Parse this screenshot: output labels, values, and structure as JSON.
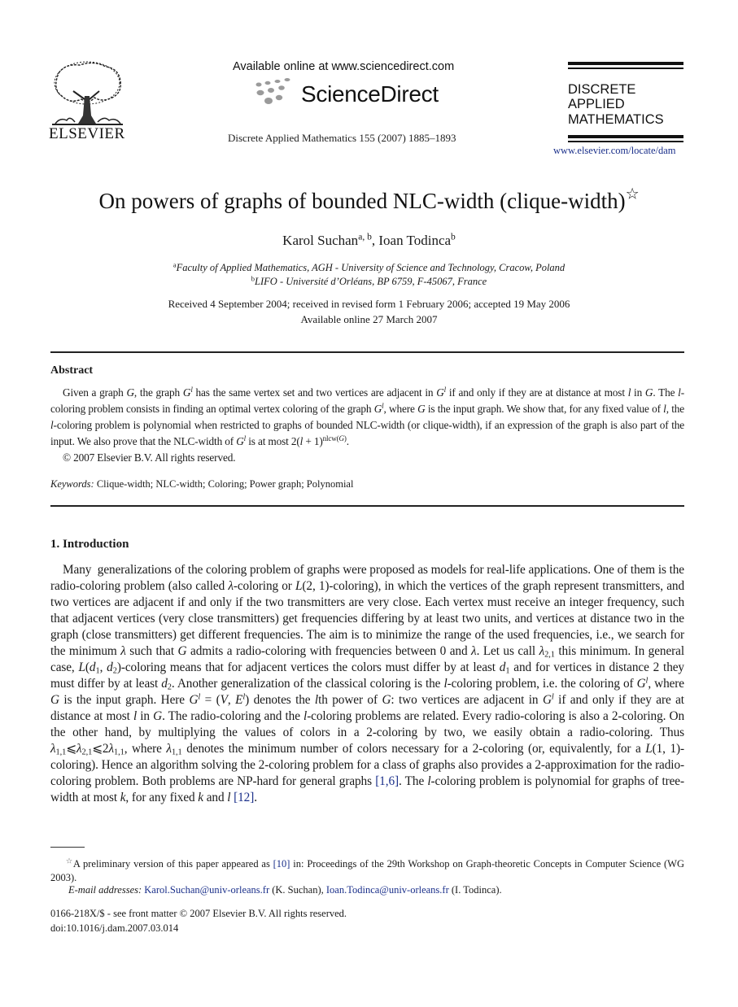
{
  "header": {
    "publisher": "ELSEVIER",
    "available_online": "Available online at www.sciencedirect.com",
    "sciencedirect": "ScienceDirect",
    "journal_ref": "Discrete Applied Mathematics 155 (2007) 1885–1893",
    "journal_title_lines": [
      "DISCRETE",
      "APPLIED",
      "MATHEMATICS"
    ],
    "journal_url": "www.elsevier.com/locate/dam"
  },
  "article": {
    "title": "On powers of graphs of bounded NLC-width (clique-width)",
    "title_note_mark": "☆",
    "authors": [
      {
        "name": "Karol Suchan",
        "affil": "a, b"
      },
      {
        "name": "Ioan Todinca",
        "affil": "b"
      }
    ],
    "author_separator": ", ",
    "affiliations": [
      {
        "mark": "a",
        "text": "Faculty of Applied Mathematics, AGH - University of Science and Technology, Cracow, Poland"
      },
      {
        "mark": "b",
        "text": "LIFO - Université d’Orléans, BP 6759, F-45067, France"
      }
    ],
    "dates": "Received 4 September 2004; received in revised form 1 February 2006; accepted 19 May 2006",
    "available": "Available online 27 March 2007"
  },
  "abstract": {
    "heading": "Abstract",
    "copyright": "© 2007 Elsevier B.V. All rights reserved."
  },
  "keywords": {
    "label": "Keywords:",
    "text": "Clique-width; NLC-width; Coloring; Power graph; Polynomial"
  },
  "section": {
    "heading": "1.  Introduction",
    "citations": [
      "[1,6]",
      "[12]"
    ]
  },
  "footnotes": {
    "mark": "☆",
    "preliminary_pre": "A preliminary version of this paper appeared as ",
    "preliminary_ref": "[10]",
    "preliminary_post": " in: Proceedings of the 29th Workshop on Graph-theoretic Concepts in Computer Science (WG 2003).",
    "email_label": "E-mail addresses:",
    "emails": [
      {
        "address": "Karol.Suchan@univ-orleans.fr",
        "who": " (K. Suchan), "
      },
      {
        "address": "Ioan.Todinca@univ-orleans.fr",
        "who": " (I. Todinca)."
      }
    ],
    "issn": "0166-218X/$ - see front matter © 2007 Elsevier B.V. All rights reserved.",
    "doi": "doi:10.1016/j.dam.2007.03.014"
  },
  "colors": {
    "link": "#1a2f8a",
    "text": "#1a1a1a"
  }
}
